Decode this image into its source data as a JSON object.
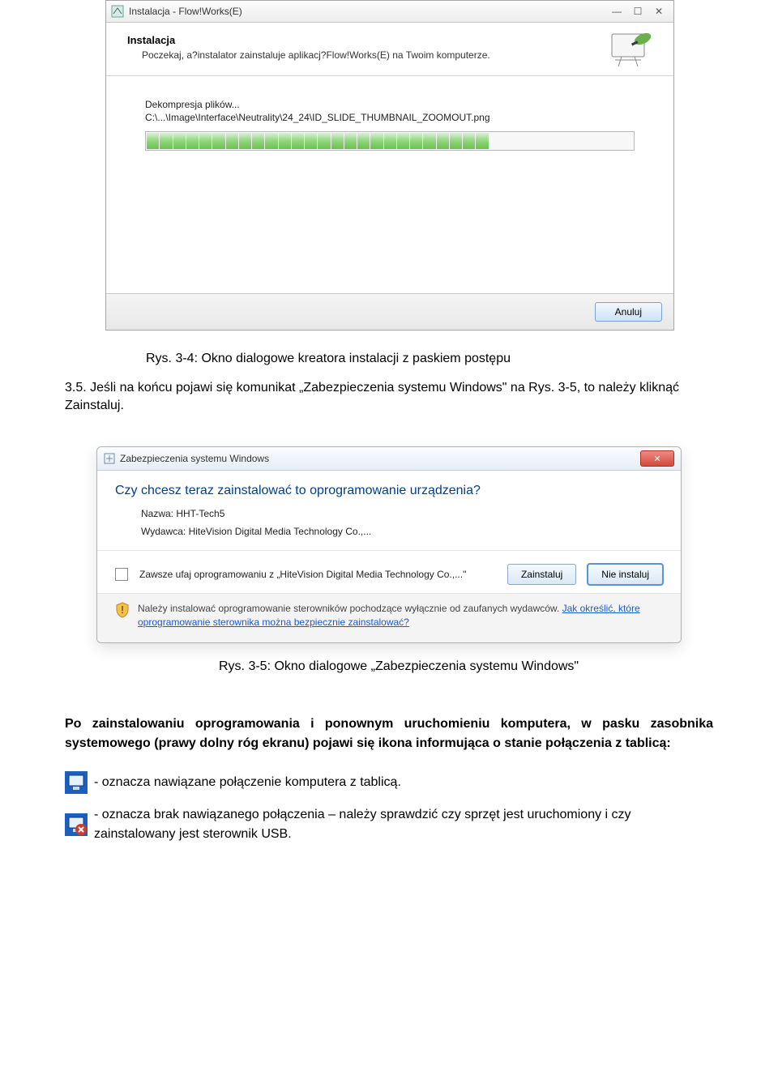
{
  "installer": {
    "window_title": "Instalacja - Flow!Works(E)",
    "header_title": "Instalacja",
    "header_sub": "Poczekaj, a?instalator zainstaluje aplikacj?Flow!Works(E) na Twoim komputerze.",
    "status_line1": "Dekompresja plików...",
    "status_line2": "C:\\...\\Image\\Interface\\Neutrality\\24_24\\ID_SLIDE_THUMBNAIL_ZOOMOUT.png",
    "cancel_label": "Anuluj",
    "progress_filled": 26,
    "progress_total": 37
  },
  "caption_3_4": "Rys. 3-4: Okno dialogowe kreatora instalacji z paskiem postępu",
  "para_3_5": "3.5. Jeśli na końcu pojawi się komunikat „Zabezpieczenia systemu Windows\" na Rys. 3-5, to należy kliknąć Zainstaluj.",
  "security": {
    "window_title": "Zabezpieczenia systemu Windows",
    "question": "Czy chcesz teraz zainstalować to oprogramowanie urządzenia?",
    "name_label": "Nazwa: HHT-Tech5",
    "publisher_label": "Wydawca: HiteVision Digital Media Technology Co.,...",
    "trust_text": "Zawsze ufaj oprogramowaniu z „HiteVision Digital Media Technology Co.,...\"",
    "install_label": "Zainstaluj",
    "noinstall_label": "Nie instaluj",
    "warn_text_1": "Należy instalować oprogramowanie sterowników pochodzące wyłącznie od zaufanych wydawców. ",
    "warn_link": "Jak określić, które oprogramowanie sterownika można bezpiecznie zainstalować?"
  },
  "caption_3_5": "Rys. 3-5: Okno dialogowe „Zabezpieczenia systemu Windows\"",
  "body_after": "Po zainstalowaniu oprogramowania i ponownym uruchomieniu komputera, w pasku zasobnika systemowego (prawy dolny róg ekranu) pojawi się ikona informująca o stanie połączenia z tablicą:",
  "legend_connected": " - oznacza nawiązane połączenie komputera z tablicą.",
  "legend_disconnected": " - oznacza brak nawiązanego połączenia – należy sprawdzić czy sprzęt jest uruchomiony i czy zainstalowany jest sterownik USB."
}
